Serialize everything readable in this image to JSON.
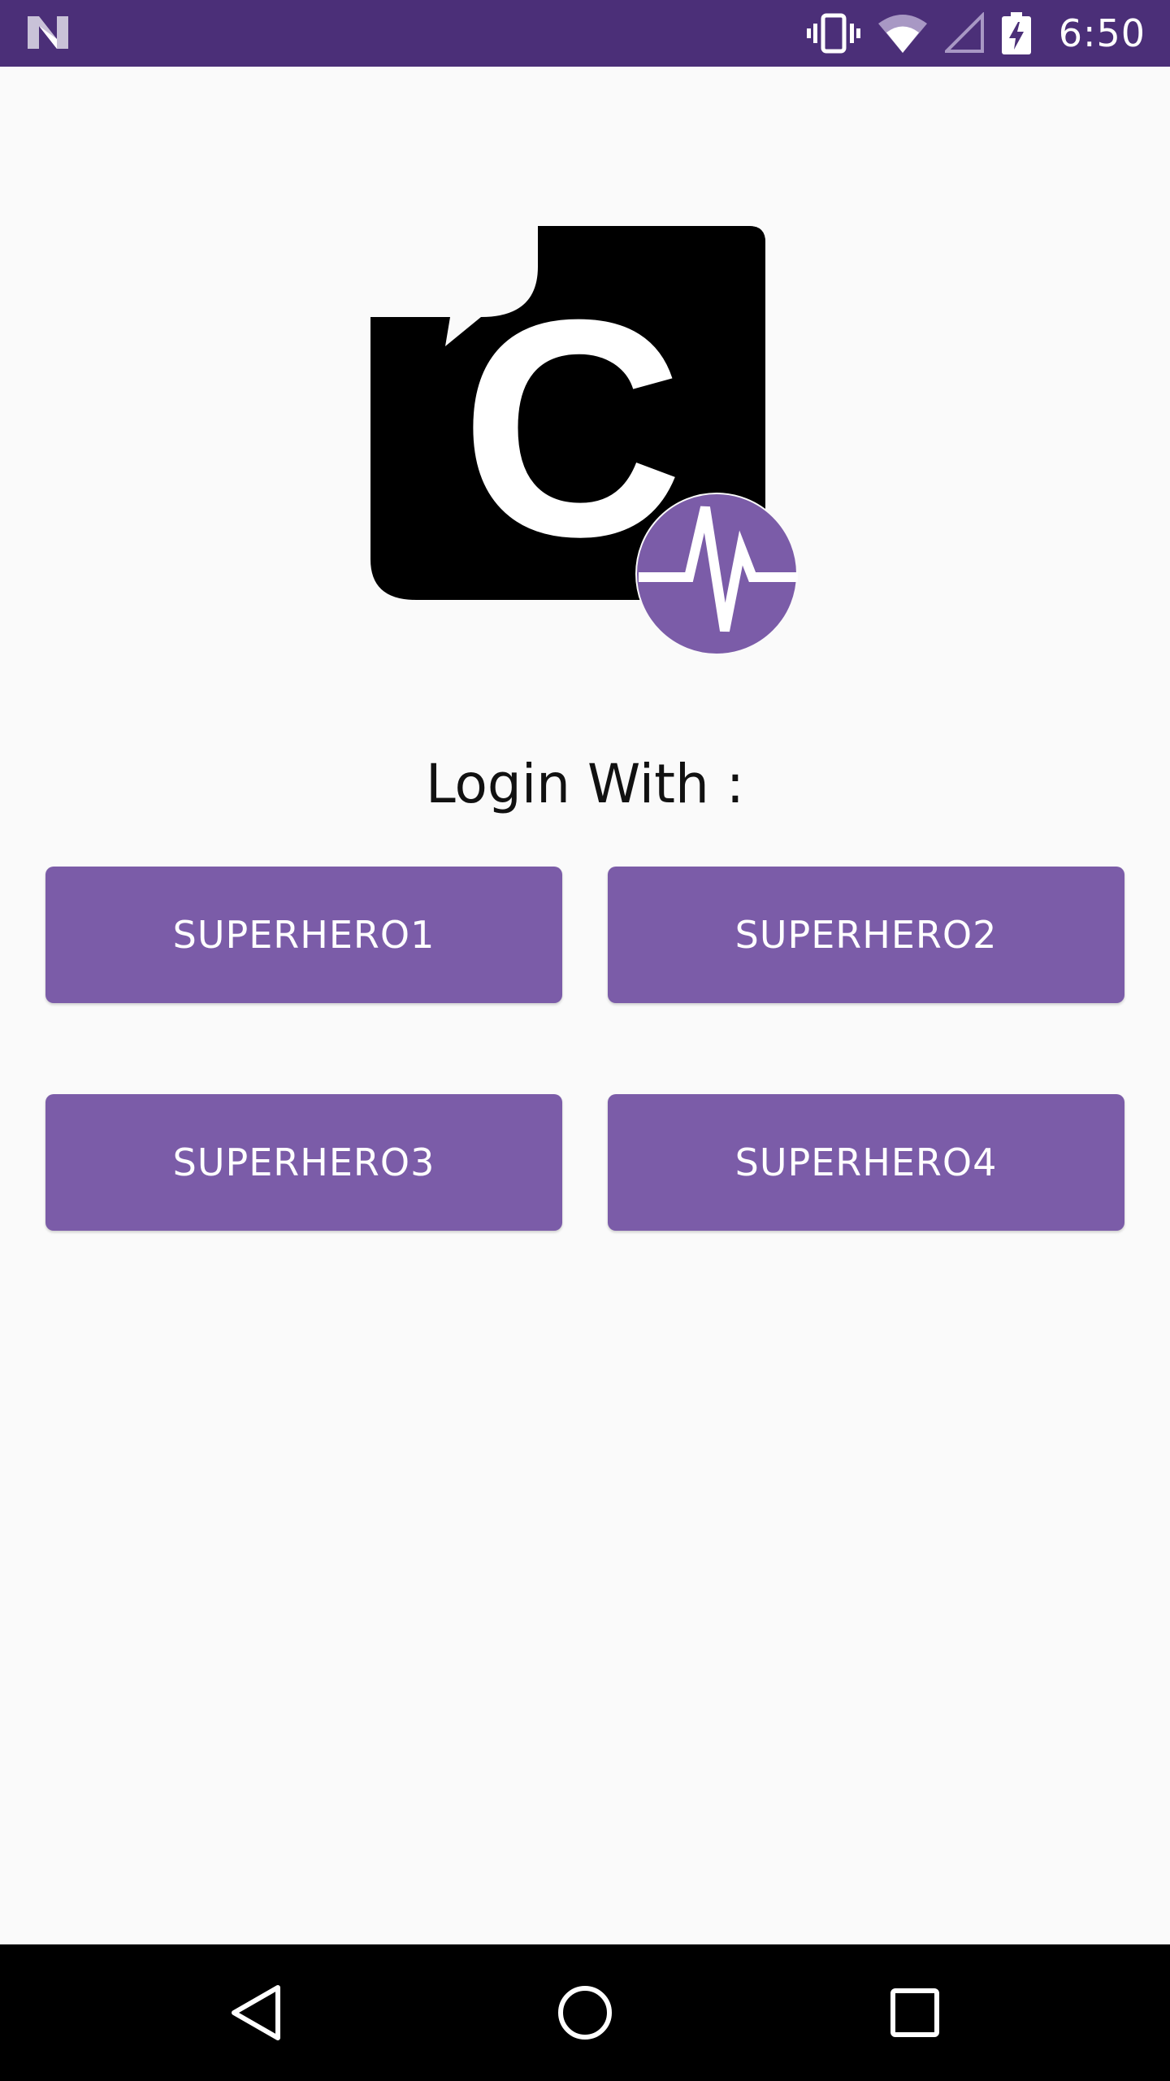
{
  "status_bar": {
    "time": "6:50",
    "background": "#4b2f78",
    "icons": [
      "notification-n-icon",
      "vibrate-icon",
      "wifi-icon",
      "cell-signal-icon",
      "battery-charging-icon"
    ]
  },
  "logo": {
    "letter": "C",
    "badge_color": "#7b5ca8",
    "badge_icon": "pulse-icon"
  },
  "login": {
    "label": "Login With :"
  },
  "buttons": [
    {
      "label": "SUPERHERO1"
    },
    {
      "label": "SUPERHERO2"
    },
    {
      "label": "SUPERHERO3"
    },
    {
      "label": "SUPERHERO4"
    }
  ],
  "colors": {
    "accent": "#7b5ca8",
    "background": "#fafafa"
  },
  "nav_bar": {
    "icons": [
      "back-icon",
      "home-icon",
      "recents-icon"
    ]
  }
}
